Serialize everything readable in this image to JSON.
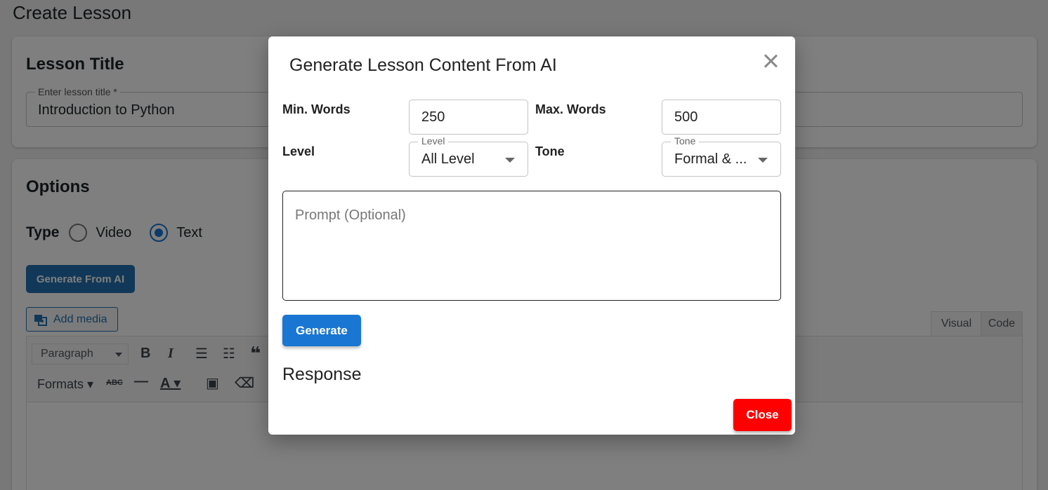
{
  "page": {
    "title": "Create Lesson"
  },
  "lesson_title": {
    "heading": "Lesson Title",
    "field_label": "Enter lesson title *",
    "field_value": "Introduction to Python"
  },
  "options": {
    "heading": "Options",
    "type_label": "Type",
    "type_options": [
      "Video",
      "Text"
    ],
    "type_selected": "Text",
    "generate_ai_label": "Generate From AI",
    "add_media_label": "Add media",
    "editor_tabs": [
      "Visual",
      "Code"
    ],
    "toolbar": {
      "paragraph_select": "Paragraph",
      "formats_label": "Formats"
    }
  },
  "modal": {
    "title": "Generate Lesson Content From AI",
    "min_words_label": "Min. Words",
    "min_words_value": "250",
    "max_words_label": "Max. Words",
    "max_words_value": "500",
    "level_label": "Level",
    "level_field_legend": "Level",
    "level_value": "All Level",
    "tone_label": "Tone",
    "tone_field_legend": "Tone",
    "tone_value": "Formal & ...",
    "prompt_placeholder": "Prompt (Optional)",
    "generate_label": "Generate",
    "response_heading": "Response",
    "close_label": "Close"
  },
  "colors": {
    "primary": "#1976d2",
    "wp_blue": "#2271b1",
    "danger": "#ff0000"
  }
}
